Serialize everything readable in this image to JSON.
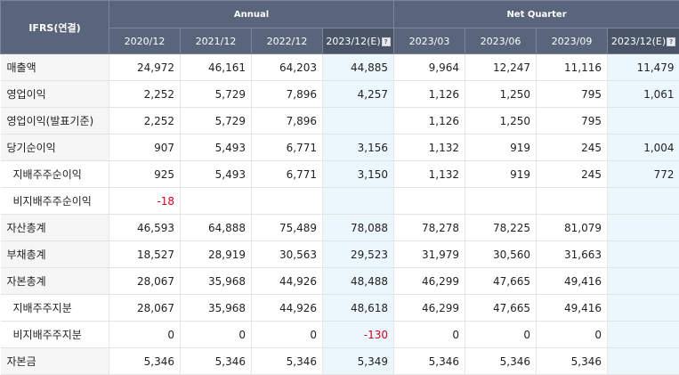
{
  "header": {
    "corner_label": "IFRS(연결)",
    "groups": [
      {
        "label": "Annual"
      },
      {
        "label": "Net Quarter"
      }
    ],
    "annual_periods": [
      {
        "label": "2020/12",
        "estimate": false
      },
      {
        "label": "2021/12",
        "estimate": false
      },
      {
        "label": "2022/12",
        "estimate": false
      },
      {
        "label": "2023/12(E)",
        "estimate": true
      }
    ],
    "quarter_periods": [
      {
        "label": "2023/03",
        "estimate": false
      },
      {
        "label": "2023/06",
        "estimate": false
      },
      {
        "label": "2023/09",
        "estimate": false
      },
      {
        "label": "2023/12(E)",
        "estimate": true
      }
    ],
    "help_icon_glyph": "?"
  },
  "rows": [
    {
      "label": "매출액",
      "sub": false,
      "annual": [
        "24,972",
        "46,161",
        "64,203",
        "44,885"
      ],
      "quarter": [
        "9,964",
        "12,247",
        "11,116",
        "11,479"
      ]
    },
    {
      "label": "영업이익",
      "sub": false,
      "annual": [
        "2,252",
        "5,729",
        "7,896",
        "4,257"
      ],
      "quarter": [
        "1,126",
        "1,250",
        "795",
        "1,061"
      ]
    },
    {
      "label": "영업이익(발표기준)",
      "sub": false,
      "annual": [
        "2,252",
        "5,729",
        "7,896",
        ""
      ],
      "quarter": [
        "1,126",
        "1,250",
        "795",
        ""
      ]
    },
    {
      "label": "당기순이익",
      "sub": false,
      "annual": [
        "907",
        "5,493",
        "6,771",
        "3,156"
      ],
      "quarter": [
        "1,132",
        "919",
        "245",
        "1,004"
      ]
    },
    {
      "label": "지배주주순이익",
      "sub": true,
      "annual": [
        "925",
        "5,493",
        "6,771",
        "3,150"
      ],
      "quarter": [
        "1,132",
        "919",
        "245",
        "772"
      ]
    },
    {
      "label": "비지배주주순이익",
      "sub": true,
      "annual": [
        "-18",
        "",
        "",
        ""
      ],
      "quarter": [
        "",
        "",
        "",
        ""
      ]
    },
    {
      "label": "자산총계",
      "sub": false,
      "annual": [
        "46,593",
        "64,888",
        "75,489",
        "78,088"
      ],
      "quarter": [
        "78,278",
        "78,225",
        "81,079",
        ""
      ]
    },
    {
      "label": "부채총계",
      "sub": false,
      "annual": [
        "18,527",
        "28,919",
        "30,563",
        "29,523"
      ],
      "quarter": [
        "31,979",
        "30,560",
        "31,663",
        ""
      ]
    },
    {
      "label": "자본총계",
      "sub": false,
      "annual": [
        "28,067",
        "35,968",
        "44,926",
        "48,488"
      ],
      "quarter": [
        "46,299",
        "47,665",
        "49,416",
        ""
      ]
    },
    {
      "label": "지배주주지분",
      "sub": true,
      "annual": [
        "28,067",
        "35,968",
        "44,926",
        "48,618"
      ],
      "quarter": [
        "46,299",
        "47,665",
        "49,416",
        ""
      ]
    },
    {
      "label": "비지배주주지분",
      "sub": true,
      "annual": [
        "0",
        "0",
        "0",
        "-130"
      ],
      "quarter": [
        "0",
        "0",
        "0",
        ""
      ]
    },
    {
      "label": "자본금",
      "sub": false,
      "annual": [
        "5,346",
        "5,346",
        "5,346",
        "5,349"
      ],
      "quarter": [
        "5,346",
        "5,346",
        "5,346",
        ""
      ]
    }
  ],
  "colors": {
    "header_bg": "#59657a",
    "estimate_col_bg": "#ecf6fd",
    "negative_text": "#d0021b",
    "label_col_bg": "#f6f6f6"
  }
}
